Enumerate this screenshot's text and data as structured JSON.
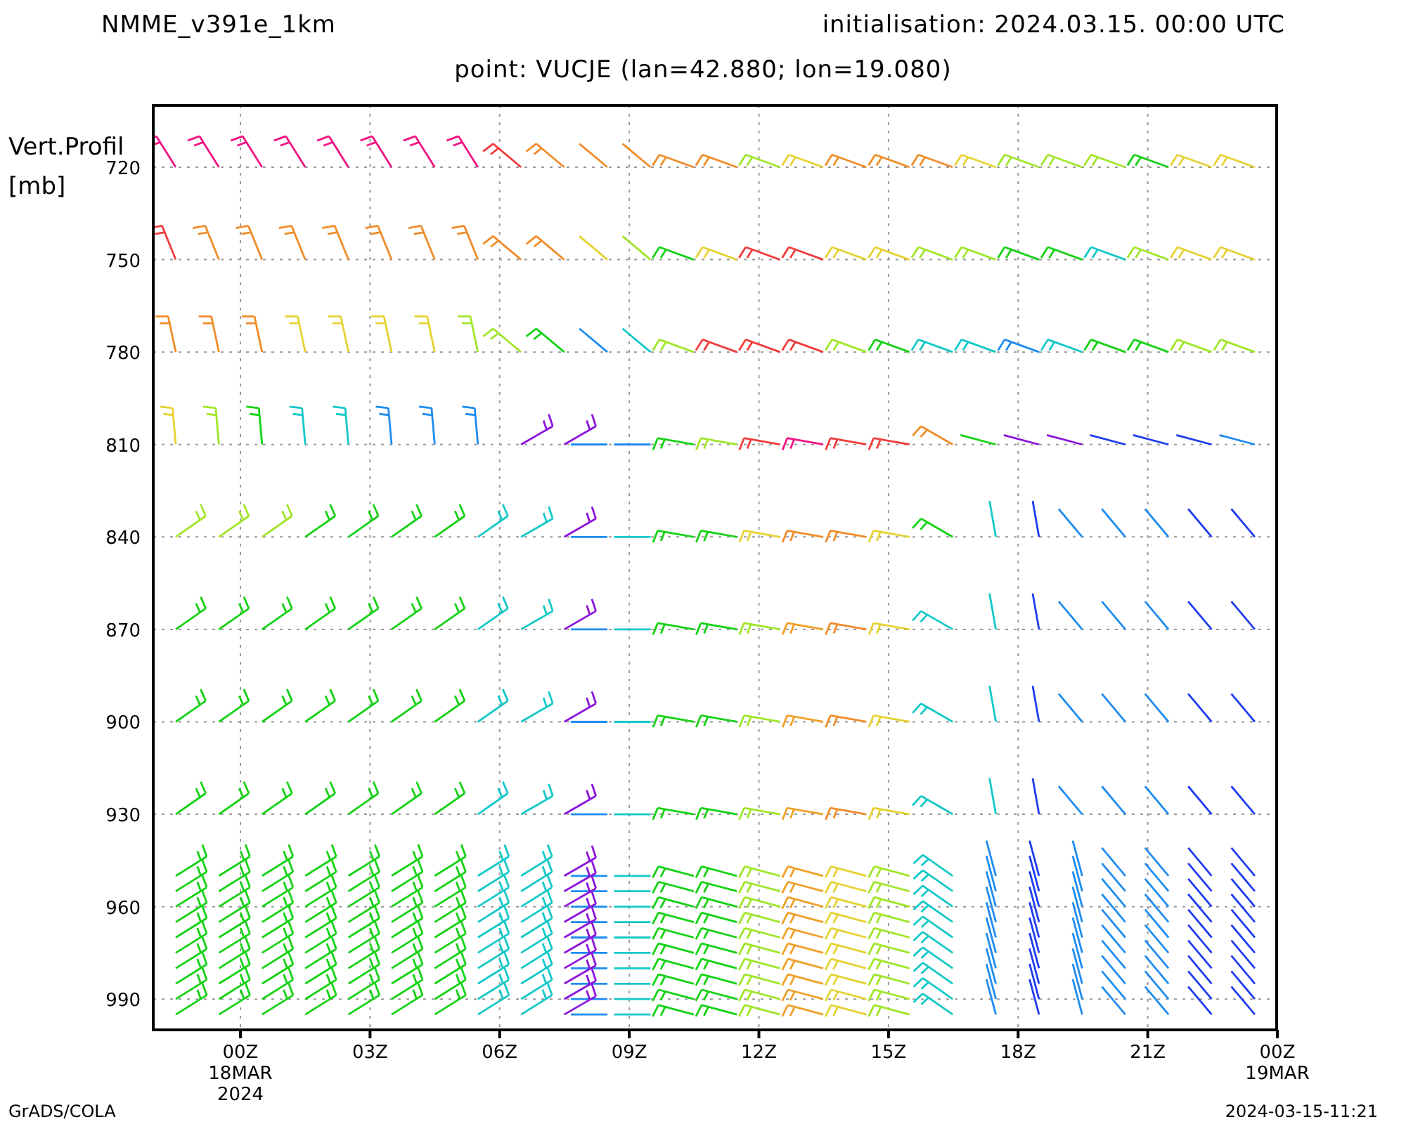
{
  "header": {
    "model": "NMME_v391e_1km",
    "initialisation": "initialisation: 2024.03.15. 00:00 UTC"
  },
  "plot": {
    "subtitle": "point: VUCJE (lan=42.880; lon=19.080)",
    "y_axis_label": [
      "Vert.Profil",
      "[mb]"
    ],
    "y_ticks": [
      "720",
      "750",
      "780",
      "810",
      "840",
      "870",
      "900",
      "930",
      "960",
      "990"
    ],
    "x_ticks": [
      {
        "lines": [
          "00Z",
          "18MAR",
          "2024"
        ]
      },
      {
        "lines": [
          "03Z"
        ]
      },
      {
        "lines": [
          "06Z"
        ]
      },
      {
        "lines": [
          "09Z"
        ]
      },
      {
        "lines": [
          "12Z"
        ]
      },
      {
        "lines": [
          "15Z"
        ]
      },
      {
        "lines": [
          "18Z"
        ]
      },
      {
        "lines": [
          "21Z"
        ]
      },
      {
        "lines": [
          "00Z",
          "19MAR"
        ]
      }
    ]
  },
  "footer": {
    "left": "GrADS/COLA",
    "right": "2024-03-15-11:21"
  }
}
